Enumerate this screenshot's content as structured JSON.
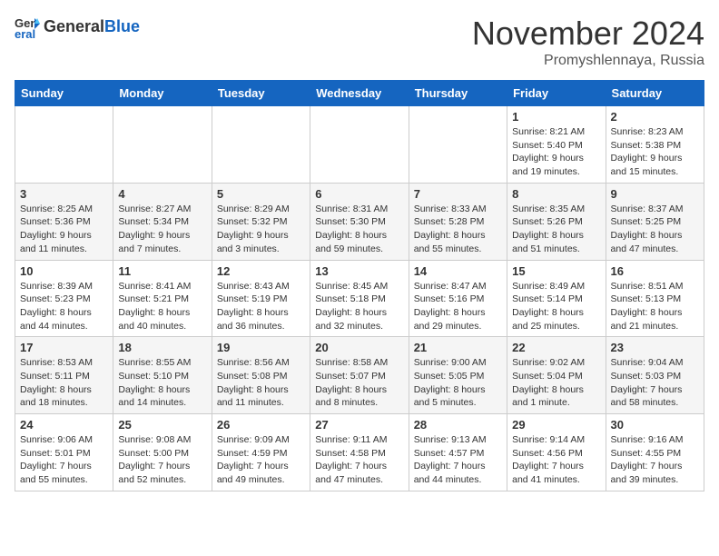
{
  "logo": {
    "general": "General",
    "blue": "Blue"
  },
  "header": {
    "title": "November 2024",
    "location": "Promyshlennaya, Russia"
  },
  "days_of_week": [
    "Sunday",
    "Monday",
    "Tuesday",
    "Wednesday",
    "Thursday",
    "Friday",
    "Saturday"
  ],
  "weeks": [
    [
      {
        "day": "",
        "info": ""
      },
      {
        "day": "",
        "info": ""
      },
      {
        "day": "",
        "info": ""
      },
      {
        "day": "",
        "info": ""
      },
      {
        "day": "",
        "info": ""
      },
      {
        "day": "1",
        "info": "Sunrise: 8:21 AM\nSunset: 5:40 PM\nDaylight: 9 hours and 19 minutes."
      },
      {
        "day": "2",
        "info": "Sunrise: 8:23 AM\nSunset: 5:38 PM\nDaylight: 9 hours and 15 minutes."
      }
    ],
    [
      {
        "day": "3",
        "info": "Sunrise: 8:25 AM\nSunset: 5:36 PM\nDaylight: 9 hours and 11 minutes."
      },
      {
        "day": "4",
        "info": "Sunrise: 8:27 AM\nSunset: 5:34 PM\nDaylight: 9 hours and 7 minutes."
      },
      {
        "day": "5",
        "info": "Sunrise: 8:29 AM\nSunset: 5:32 PM\nDaylight: 9 hours and 3 minutes."
      },
      {
        "day": "6",
        "info": "Sunrise: 8:31 AM\nSunset: 5:30 PM\nDaylight: 8 hours and 59 minutes."
      },
      {
        "day": "7",
        "info": "Sunrise: 8:33 AM\nSunset: 5:28 PM\nDaylight: 8 hours and 55 minutes."
      },
      {
        "day": "8",
        "info": "Sunrise: 8:35 AM\nSunset: 5:26 PM\nDaylight: 8 hours and 51 minutes."
      },
      {
        "day": "9",
        "info": "Sunrise: 8:37 AM\nSunset: 5:25 PM\nDaylight: 8 hours and 47 minutes."
      }
    ],
    [
      {
        "day": "10",
        "info": "Sunrise: 8:39 AM\nSunset: 5:23 PM\nDaylight: 8 hours and 44 minutes."
      },
      {
        "day": "11",
        "info": "Sunrise: 8:41 AM\nSunset: 5:21 PM\nDaylight: 8 hours and 40 minutes."
      },
      {
        "day": "12",
        "info": "Sunrise: 8:43 AM\nSunset: 5:19 PM\nDaylight: 8 hours and 36 minutes."
      },
      {
        "day": "13",
        "info": "Sunrise: 8:45 AM\nSunset: 5:18 PM\nDaylight: 8 hours and 32 minutes."
      },
      {
        "day": "14",
        "info": "Sunrise: 8:47 AM\nSunset: 5:16 PM\nDaylight: 8 hours and 29 minutes."
      },
      {
        "day": "15",
        "info": "Sunrise: 8:49 AM\nSunset: 5:14 PM\nDaylight: 8 hours and 25 minutes."
      },
      {
        "day": "16",
        "info": "Sunrise: 8:51 AM\nSunset: 5:13 PM\nDaylight: 8 hours and 21 minutes."
      }
    ],
    [
      {
        "day": "17",
        "info": "Sunrise: 8:53 AM\nSunset: 5:11 PM\nDaylight: 8 hours and 18 minutes."
      },
      {
        "day": "18",
        "info": "Sunrise: 8:55 AM\nSunset: 5:10 PM\nDaylight: 8 hours and 14 minutes."
      },
      {
        "day": "19",
        "info": "Sunrise: 8:56 AM\nSunset: 5:08 PM\nDaylight: 8 hours and 11 minutes."
      },
      {
        "day": "20",
        "info": "Sunrise: 8:58 AM\nSunset: 5:07 PM\nDaylight: 8 hours and 8 minutes."
      },
      {
        "day": "21",
        "info": "Sunrise: 9:00 AM\nSunset: 5:05 PM\nDaylight: 8 hours and 5 minutes."
      },
      {
        "day": "22",
        "info": "Sunrise: 9:02 AM\nSunset: 5:04 PM\nDaylight: 8 hours and 1 minute."
      },
      {
        "day": "23",
        "info": "Sunrise: 9:04 AM\nSunset: 5:03 PM\nDaylight: 7 hours and 58 minutes."
      }
    ],
    [
      {
        "day": "24",
        "info": "Sunrise: 9:06 AM\nSunset: 5:01 PM\nDaylight: 7 hours and 55 minutes."
      },
      {
        "day": "25",
        "info": "Sunrise: 9:08 AM\nSunset: 5:00 PM\nDaylight: 7 hours and 52 minutes."
      },
      {
        "day": "26",
        "info": "Sunrise: 9:09 AM\nSunset: 4:59 PM\nDaylight: 7 hours and 49 minutes."
      },
      {
        "day": "27",
        "info": "Sunrise: 9:11 AM\nSunset: 4:58 PM\nDaylight: 7 hours and 47 minutes."
      },
      {
        "day": "28",
        "info": "Sunrise: 9:13 AM\nSunset: 4:57 PM\nDaylight: 7 hours and 44 minutes."
      },
      {
        "day": "29",
        "info": "Sunrise: 9:14 AM\nSunset: 4:56 PM\nDaylight: 7 hours and 41 minutes."
      },
      {
        "day": "30",
        "info": "Sunrise: 9:16 AM\nSunset: 4:55 PM\nDaylight: 7 hours and 39 minutes."
      }
    ]
  ]
}
